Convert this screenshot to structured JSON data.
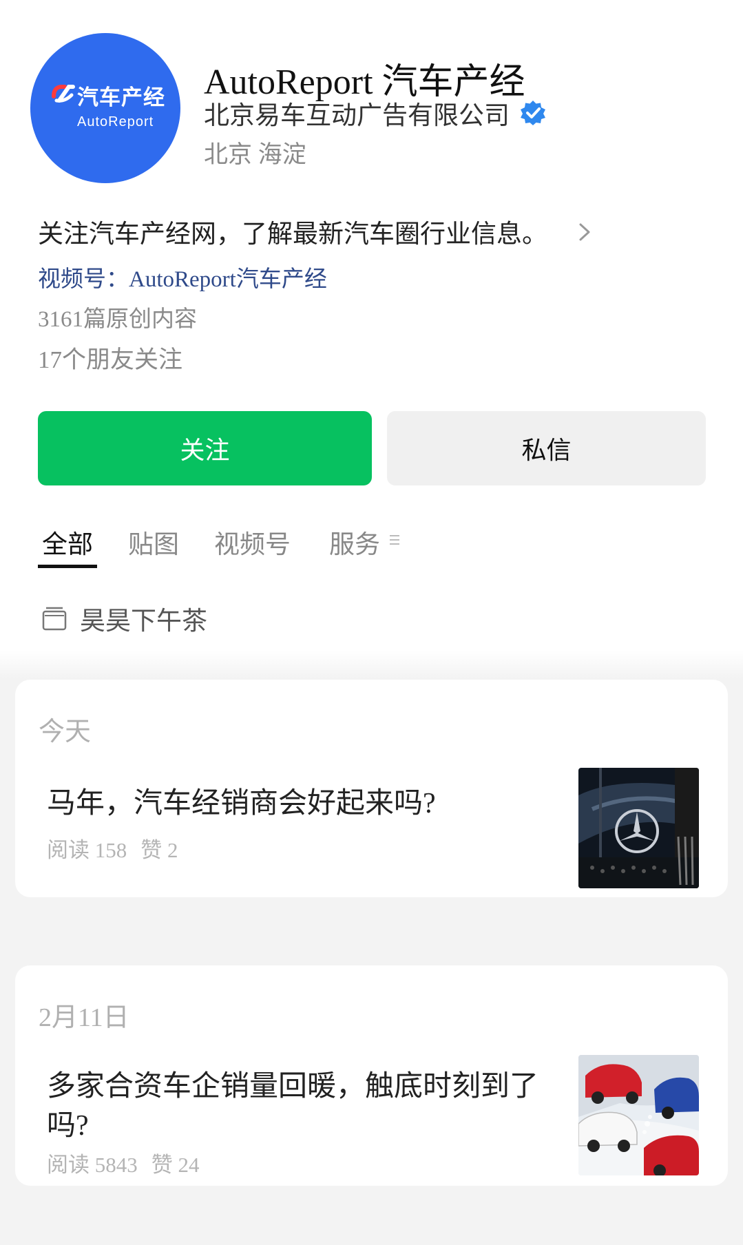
{
  "header": {
    "avatar": {
      "logo_cn": "汽车产经",
      "logo_en": "AutoReport",
      "background": "#2f6bee"
    },
    "account_name": "AutoReport 汽车产经",
    "company": "北京易车互动广告有限公司",
    "verified_icon": "verified-badge-icon",
    "location": "北京 海淀"
  },
  "profile": {
    "intro": "关注汽车产经网，了解最新汽车圈行业信息。",
    "channel": "视频号：AutoReport汽车产经",
    "articles_count": "3161篇原创内容",
    "friends_count": "17个朋友关注"
  },
  "actions": {
    "follow_label": "关注",
    "message_label": "私信",
    "follow_color": "#07c160"
  },
  "tabs": [
    {
      "label": "全部",
      "active": true
    },
    {
      "label": "贴图",
      "active": false
    },
    {
      "label": "视频号",
      "active": false
    },
    {
      "label": "服务",
      "active": false
    }
  ],
  "collection": {
    "label": "昊昊下午茶",
    "icon": "folder-icon"
  },
  "feed": [
    {
      "date": "今天",
      "title": "马年，汽车经销商会好起来吗?",
      "reads": "阅读 158",
      "likes": "赞 2",
      "thumbnail": "mercedes-grille-photo"
    },
    {
      "date": "2月11日",
      "title": "多家合资车企销量回暖，触底时刻到了吗?",
      "reads": "阅读 5843",
      "likes": "赞 24",
      "thumbnail": "cars-collage-photo"
    }
  ]
}
